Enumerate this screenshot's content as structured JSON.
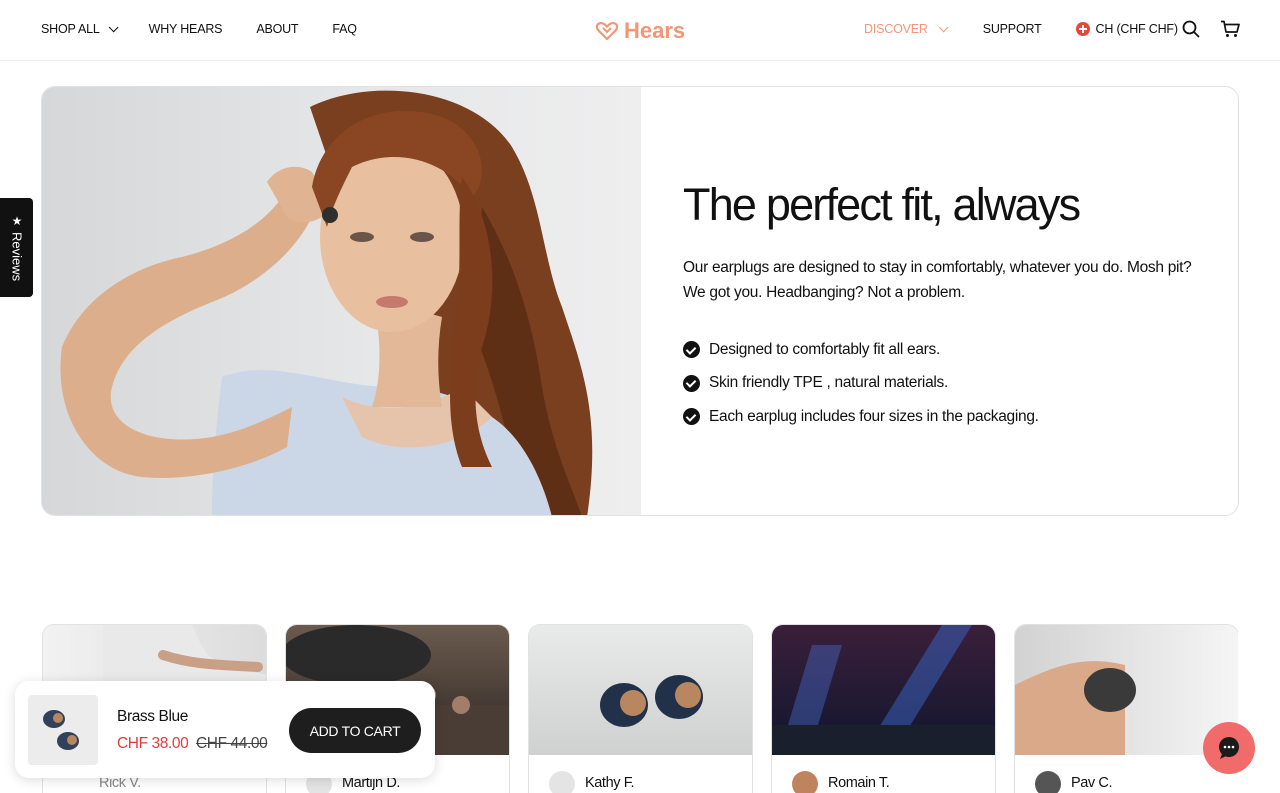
{
  "header": {
    "nav_left": [
      {
        "label": "SHOP ALL",
        "dropdown": true
      },
      {
        "label": "WHY HEARS",
        "dropdown": false
      },
      {
        "label": "ABOUT",
        "dropdown": false
      },
      {
        "label": "FAQ",
        "dropdown": false
      }
    ],
    "logo_text": "Hears",
    "discover_label": "DISCOVER",
    "support_label": "SUPPORT",
    "currency_label": "CH (CHF CHF)",
    "icons": [
      "search-icon",
      "cart-icon"
    ]
  },
  "reviews_tab": {
    "label": "Reviews",
    "icon": "star-icon"
  },
  "hero": {
    "title": "The perfect fit, always",
    "description": "Our earplugs are designed to stay in comfortably, whatever you do. Mosh pit? We got you. Headbanging? Not a problem.",
    "features": [
      "Designed to comfortably fit all ears.",
      "Skin friendly TPE , natural materials.",
      "Each earplug includes four sizes in the packaging."
    ]
  },
  "review_cards": [
    {
      "name": "Rick V."
    },
    {
      "name": "Martijn D."
    },
    {
      "name": "Kathy F."
    },
    {
      "name": "Romain T."
    },
    {
      "name": "Pav C."
    }
  ],
  "sticky_cart": {
    "product_name": "Brass Blue",
    "price": "CHF 38.00",
    "old_price": "CHF 44.00",
    "button_label": "ADD TO CART"
  },
  "colors": {
    "accent": "#f19677",
    "sale": "#e23c3c",
    "chat": "#f26b6b",
    "dark": "#1e1e1e"
  }
}
